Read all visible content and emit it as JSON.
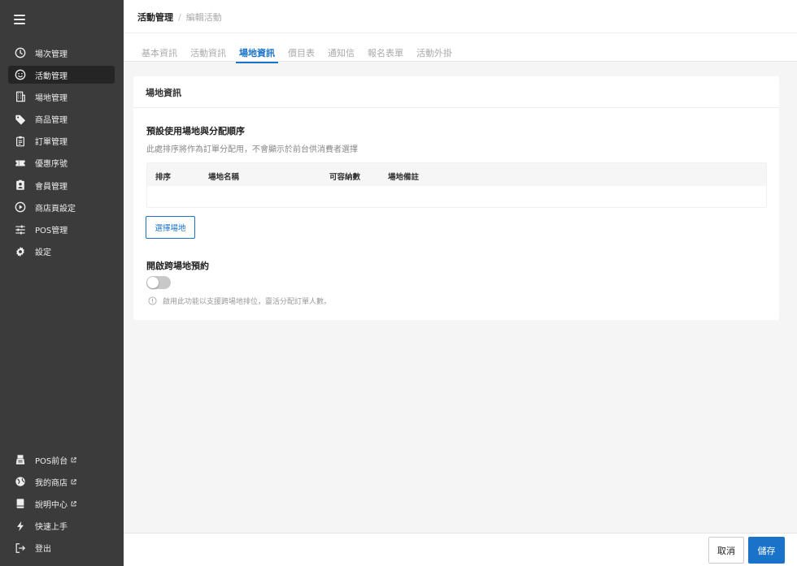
{
  "sidebar": {
    "items": [
      {
        "label": "場次管理",
        "icon": "clock-icon"
      },
      {
        "label": "活動管理",
        "icon": "smiley-icon",
        "active": true
      },
      {
        "label": "場地管理",
        "icon": "building-icon"
      },
      {
        "label": "商品管理",
        "icon": "tag-icon"
      },
      {
        "label": "訂單管理",
        "icon": "clipboard-icon"
      },
      {
        "label": "優惠序號",
        "icon": "ticket-icon"
      },
      {
        "label": "會員管理",
        "icon": "member-icon"
      },
      {
        "label": "商店頁設定",
        "icon": "play-circle-icon"
      },
      {
        "label": "POS管理",
        "icon": "sliders-icon"
      },
      {
        "label": "設定",
        "icon": "gear-icon"
      }
    ],
    "bottom_items": [
      {
        "label": "POS前台",
        "icon": "register-icon",
        "external": true
      },
      {
        "label": "我的商店",
        "icon": "globe-icon",
        "external": true
      },
      {
        "label": "說明中心",
        "icon": "book-icon",
        "external": true
      },
      {
        "label": "快速上手",
        "icon": "lightning-icon"
      },
      {
        "label": "登出",
        "icon": "logout-icon"
      }
    ]
  },
  "header": {
    "breadcrumb_main": "活動管理",
    "breadcrumb_separator": "/",
    "breadcrumb_sub": "編輯活動"
  },
  "tabs": [
    {
      "label": "基本資訊"
    },
    {
      "label": "活動資訊"
    },
    {
      "label": "場地資訊",
      "active": true
    },
    {
      "label": "價目表"
    },
    {
      "label": "通知信"
    },
    {
      "label": "報名表單"
    },
    {
      "label": "活動外掛"
    }
  ],
  "card": {
    "title": "場地資訊",
    "section_title": "預設使用場地與分配順序",
    "section_desc": "此處排序將作為訂單分配用，不會顯示於前台供消費者選擇",
    "table_headers": [
      "排序",
      "場地名稱",
      "可容納數",
      "場地備註"
    ],
    "select_button": "選擇場地",
    "cross_title": "開啟跨場地預約",
    "toggle_on": false,
    "hint": "啟用此功能以支援跨場地排位，靈活分配訂單人數。"
  },
  "footer": {
    "cancel_label": "取消",
    "save_label": "儲存"
  },
  "colors": {
    "accent": "#1a73c8",
    "sidebar_bg": "#3b3b3b"
  }
}
